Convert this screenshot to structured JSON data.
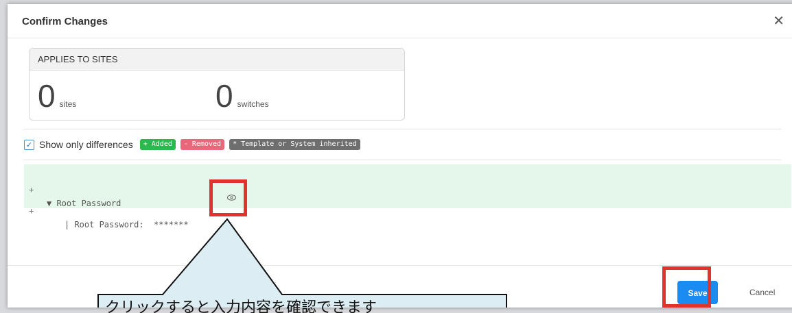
{
  "modal": {
    "title": "Confirm Changes",
    "close_icon": "close-icon"
  },
  "applies": {
    "header": "APPLIES TO SITES",
    "sites_count": "0",
    "sites_unit": "sites",
    "switches_count": "0",
    "switches_unit": "switches"
  },
  "filter": {
    "show_only_differences_label": "Show only differences",
    "checked": true,
    "badges": {
      "added": "+ Added",
      "removed": "- Removed",
      "inherited": "* Template or System inherited"
    }
  },
  "diff": {
    "lines": [
      {
        "sign": "+",
        "content": "▼ Root Password"
      },
      {
        "sign": "+",
        "content": "| Root Password:  *******"
      }
    ],
    "eye_icon": "eye-icon"
  },
  "footer": {
    "save_label": "Save",
    "cancel_label": "Cancel"
  },
  "callout": {
    "text": "クリックすると入力内容を確認できます"
  },
  "colors": {
    "accent": "#1a8bf0",
    "highlight_red": "#e1322b",
    "added_bg": "#e4f7ea",
    "added_badge": "#2db84d",
    "removed_badge": "#e8677a",
    "inherited_badge": "#6e6e6e",
    "callout_bg": "#dcedf3"
  }
}
